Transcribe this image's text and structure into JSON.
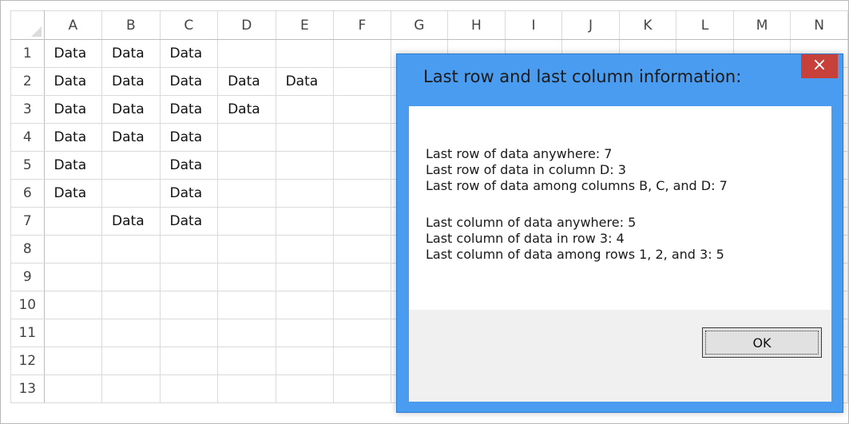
{
  "spreadsheet": {
    "columns": [
      "A",
      "B",
      "C",
      "D",
      "E",
      "F",
      "G",
      "H",
      "I",
      "J",
      "K",
      "L",
      "M",
      "N"
    ],
    "rows": [
      {
        "n": "1",
        "cells": [
          "Data",
          "Data",
          "Data",
          "",
          "",
          "",
          "",
          "",
          "",
          "",
          "",
          "",
          "",
          ""
        ]
      },
      {
        "n": "2",
        "cells": [
          "Data",
          "Data",
          "Data",
          "Data",
          "Data",
          "",
          "",
          "",
          "",
          "",
          "",
          "",
          "",
          ""
        ]
      },
      {
        "n": "3",
        "cells": [
          "Data",
          "Data",
          "Data",
          "Data",
          "",
          "",
          "",
          "",
          "",
          "",
          "",
          "",
          "",
          ""
        ]
      },
      {
        "n": "4",
        "cells": [
          "Data",
          "Data",
          "Data",
          "",
          "",
          "",
          "",
          "",
          "",
          "",
          "",
          "",
          "",
          ""
        ]
      },
      {
        "n": "5",
        "cells": [
          "Data",
          "",
          "Data",
          "",
          "",
          "",
          "",
          "",
          "",
          "",
          "",
          "",
          "",
          ""
        ]
      },
      {
        "n": "6",
        "cells": [
          "Data",
          "",
          "Data",
          "",
          "",
          "",
          "",
          "",
          "",
          "",
          "",
          "",
          "",
          ""
        ]
      },
      {
        "n": "7",
        "cells": [
          "",
          "Data",
          "Data",
          "",
          "",
          "",
          "",
          "",
          "",
          "",
          "",
          "",
          "",
          ""
        ]
      },
      {
        "n": "8",
        "cells": [
          "",
          "",
          "",
          "",
          "",
          "",
          "",
          "",
          "",
          "",
          "",
          "",
          "",
          ""
        ]
      },
      {
        "n": "9",
        "cells": [
          "",
          "",
          "",
          "",
          "",
          "",
          "",
          "",
          "",
          "",
          "",
          "",
          "",
          ""
        ]
      },
      {
        "n": "10",
        "cells": [
          "",
          "",
          "",
          "",
          "",
          "",
          "",
          "",
          "",
          "",
          "",
          "",
          "",
          ""
        ]
      },
      {
        "n": "11",
        "cells": [
          "",
          "",
          "",
          "",
          "",
          "",
          "",
          "",
          "",
          "",
          "",
          "",
          "",
          ""
        ]
      },
      {
        "n": "12",
        "cells": [
          "",
          "",
          "",
          "",
          "",
          "",
          "",
          "",
          "",
          "",
          "",
          "",
          "",
          ""
        ]
      },
      {
        "n": "13",
        "cells": [
          "",
          "",
          "",
          "",
          "",
          "",
          "",
          "",
          "",
          "",
          "",
          "",
          "",
          ""
        ]
      }
    ]
  },
  "dialog": {
    "title": "Last row and last column information:",
    "close_icon": "close-icon",
    "close_glyph": "×",
    "lines": [
      "Last row of data anywhere: 7",
      "Last row of data in column D: 3",
      "Last row of data among columns B, C, and D: 7",
      "",
      "Last column of data anywhere: 5",
      "Last column of data in row 3: 4",
      "Last column of data among rows 1, 2, and 3: 5"
    ],
    "ok_label": "OK"
  },
  "colors": {
    "dialog_frame": "#4a9cf0",
    "close_button": "#c7403a",
    "footer": "#f0f0f0"
  }
}
